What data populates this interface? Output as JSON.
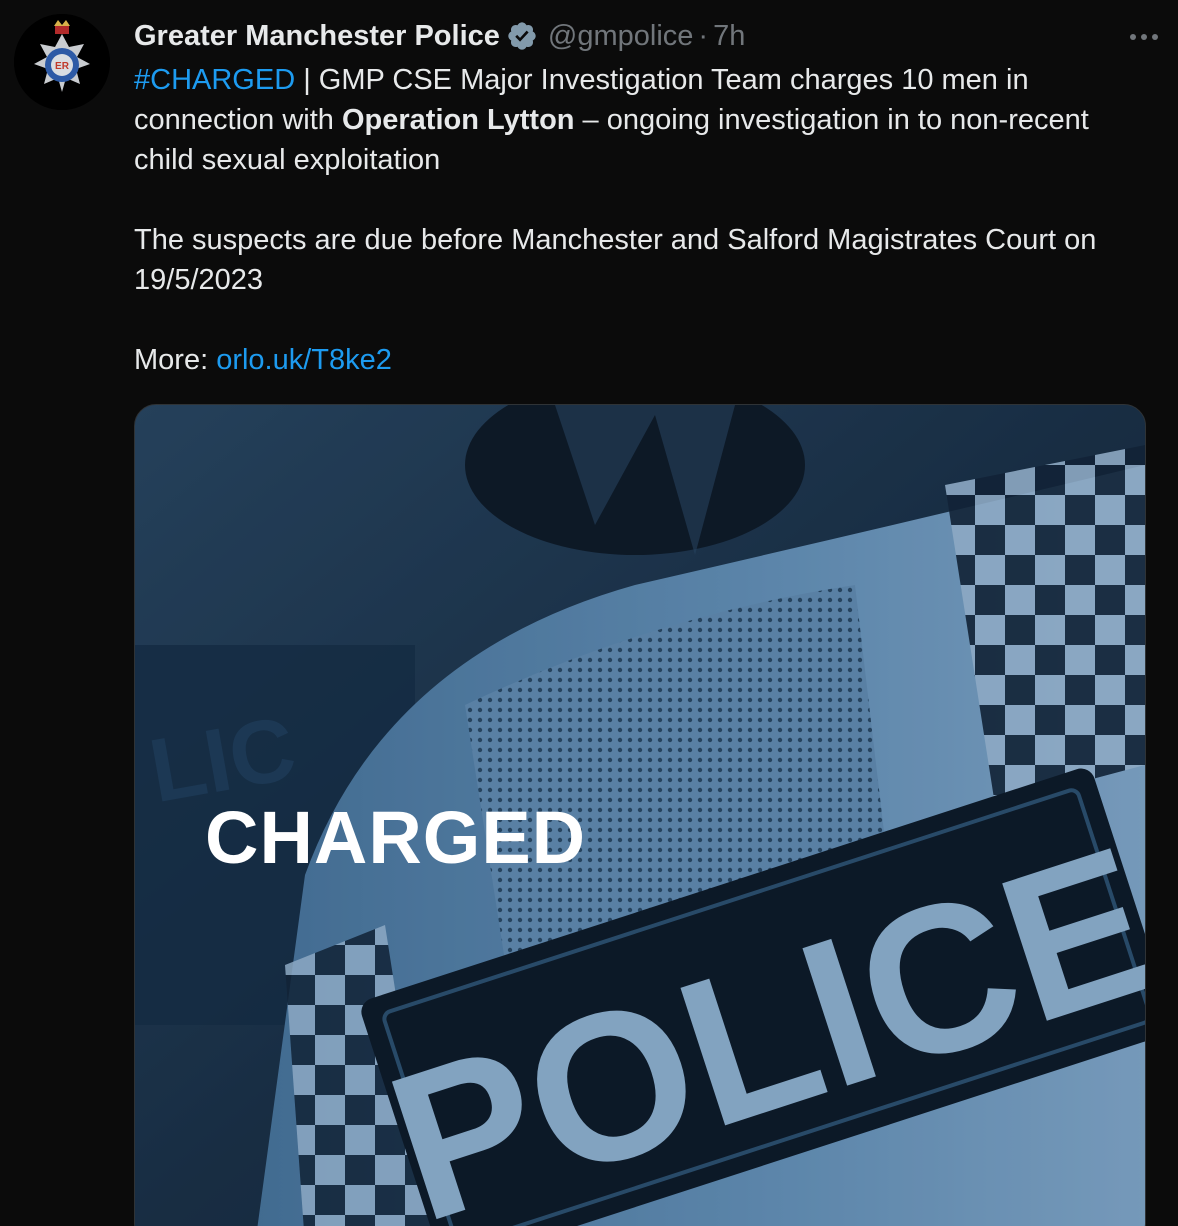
{
  "account": {
    "display_name": "Greater Manchester Police",
    "handle": "@gmpolice",
    "separator": "·",
    "time": "7h",
    "avatar_lettering": "ER"
  },
  "tweet": {
    "hashtag": "#CHARGED",
    "line1_rest": " | GMP CSE Major Investigation Team charges 10 men in connection with ",
    "bold_phrase": "Operation Lytton",
    "line1_tail": " – ongoing investigation in to non-recent child sexual exploitation",
    "paragraph2": "The suspects are due before Manchester and Salford Magistrates Court on 19/5/2023",
    "more_label": "More: ",
    "more_link": "orlo.uk/T8ke2"
  },
  "media": {
    "overlay_text": "CHARGED",
    "vest_text": "POLICE"
  },
  "colors": {
    "background": "#0b0b0b",
    "link": "#1d9bf0",
    "secondary_text": "#71767b",
    "verified_badge": "#829aab"
  },
  "icons": {
    "verified": "verified-badge-icon",
    "more": "more-dots-icon"
  }
}
